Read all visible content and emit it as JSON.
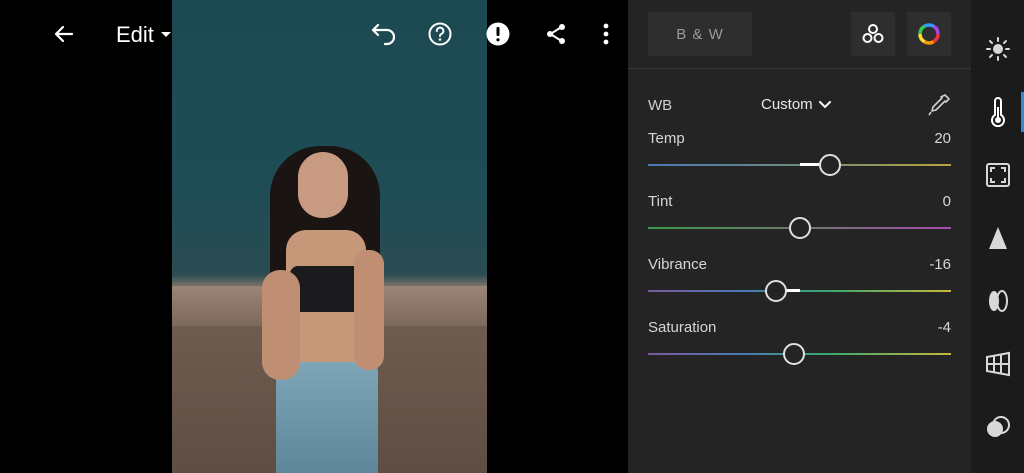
{
  "topbar": {
    "back_icon": "arrow-left-icon",
    "edit_label": "Edit",
    "undo_icon": "undo-icon",
    "help_icon": "help-circle-icon",
    "alert_icon": "exclamation-circle-icon",
    "share_icon": "share-icon",
    "more_icon": "more-vertical-icon"
  },
  "panel": {
    "bw_label": "B & W",
    "profiles_icon": "profiles-icon",
    "color_mix_icon": "color-wheel-icon",
    "wb": {
      "label": "WB",
      "value": "Custom",
      "eyedropper_icon": "eyedropper-icon"
    },
    "sliders": [
      {
        "label": "Temp",
        "value": "20",
        "position": 0.6
      },
      {
        "label": "Tint",
        "value": "0",
        "position": 0.5
      },
      {
        "label": "Vibrance",
        "value": "-16",
        "position": 0.42
      },
      {
        "label": "Saturation",
        "value": "-4",
        "position": 0.48
      }
    ]
  },
  "sidebar": {
    "items": [
      {
        "name": "light",
        "icon": "sun-icon",
        "active": false
      },
      {
        "name": "color",
        "icon": "thermometer-icon",
        "active": true
      },
      {
        "name": "effects",
        "icon": "vignette-icon",
        "active": false
      },
      {
        "name": "detail",
        "icon": "triangle-icon",
        "active": false
      },
      {
        "name": "optics",
        "icon": "lens-icon",
        "active": false
      },
      {
        "name": "geometry",
        "icon": "grid-perspective-icon",
        "active": false
      },
      {
        "name": "presets",
        "icon": "blend-circles-icon",
        "active": false
      }
    ]
  },
  "colors": {
    "accent": "#2f8bd8",
    "panel": "#242424",
    "sidebar": "#1b1b1b"
  }
}
